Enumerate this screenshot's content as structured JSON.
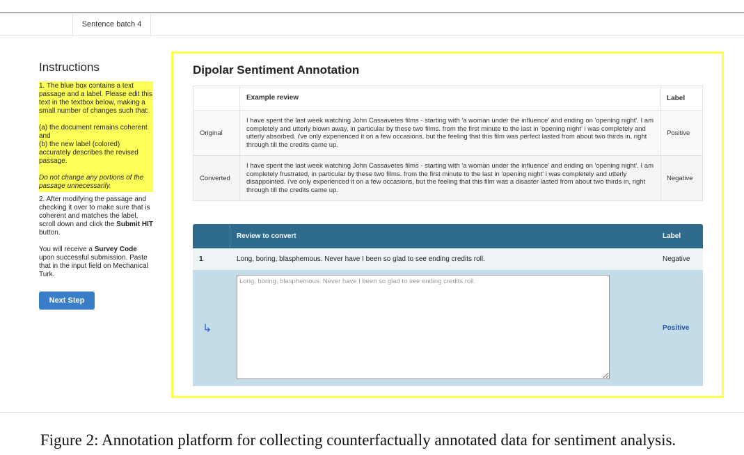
{
  "tabbar": {
    "active_tab": "Sentence batch 4"
  },
  "instructions": {
    "title": "Instructions",
    "step1_intro": "1. The blue box contains a text passage and a label. Please edit this text in the textbox below, making a small number of changes such that:",
    "step1_a": "(a) the document remains coherent and",
    "step1_b": "(b) the new label (colored) accurately describes the revised passage.",
    "step1_note": "Do not change any portions of the passage unnecessarily.",
    "step2_pre": "2. After modifying the passage and checking it over to make sure that is coherent and matches the label, scroll down and click the ",
    "step2_bold": "Submit HIT",
    "step2_post": " button.",
    "step3_pre": "You will receive a ",
    "step3_bold": "Survey Code",
    "step3_post": " upon successful submission. Paste that in the input field on Mechanical Turk.",
    "next_button": "Next Step"
  },
  "panel": {
    "title": "Dipolar Sentiment Annotation",
    "example_table": {
      "headers": [
        "",
        "Example review",
        "Label"
      ],
      "rows": [
        {
          "name": "Original",
          "review": "I have spent the last week watching John Cassavetes films - starting with 'a woman under the influence' and ending on 'opening night'. I am completely and utterly blown away, in particular by these two films. from the first minute to the last in 'opening night' i was completely and utterly absorbed. i've only experienced it on a few occasions, but the feeling that this film was perfect lasted from about two thirds in, right through till the credits came up.",
          "label": "Positive"
        },
        {
          "name": "Converted",
          "review": "I have spent the last week watching John Cassavetes films - starting with 'a woman under the influence' and ending on 'opening night'. I am completely frustrated, in particular by these two films. from the first minute to the last in 'opening night' i was completely and utterly disappointed. i've only experienced it on a few occasions, but the feeling that this film was a disaster lasted from about two thirds in, right through till the credits came up.",
          "label": "Negative"
        }
      ]
    },
    "convert_table": {
      "headers": [
        "",
        "Review to convert",
        "Label"
      ],
      "row_number": "1",
      "review": "Long, boring, blasphemous. Never have I been so glad to see ending credits roll.",
      "label": "Negative",
      "edit_arrow": "↳",
      "textarea_placeholder": "Long, boring, blasphemous. Never have I been so glad to see ending credits roll.",
      "textarea_value": "",
      "target_label": "Positive"
    }
  },
  "caption": "Figure 2: Annotation platform for collecting counterfactually annotated data for sentiment analysis.",
  "colors": {
    "highlight": "#ffff5a",
    "panel_border": "#ffff4d",
    "table_header": "#2d6a8e",
    "edit_row": "#c4dce8",
    "button": "#3a7dc9",
    "target_label": "#2255aa"
  }
}
